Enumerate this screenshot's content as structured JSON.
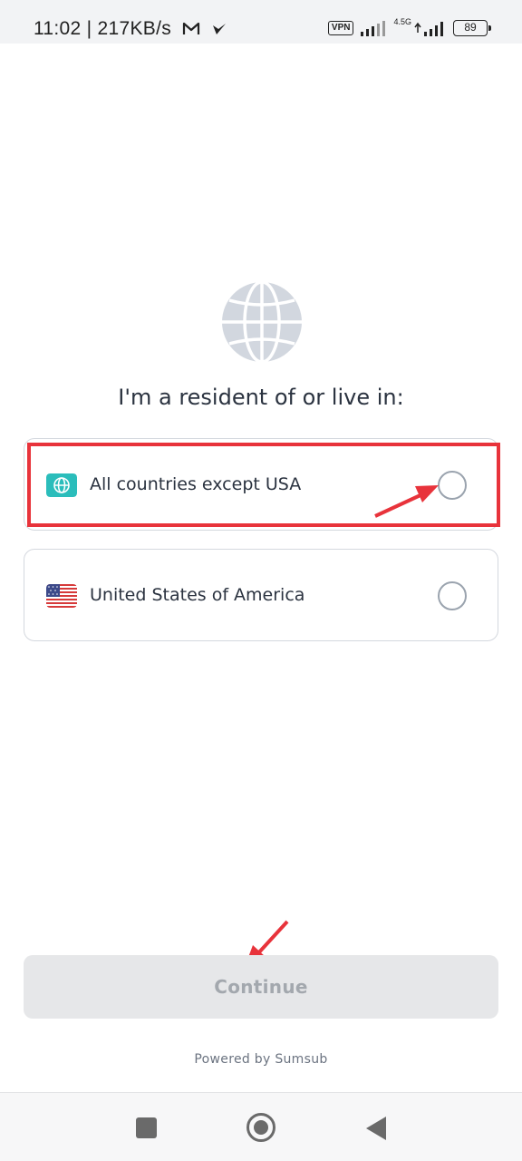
{
  "status_bar": {
    "time_speed": "11:02 | 217KB/s",
    "vpn": "VPN",
    "network": "4.5G",
    "battery": "89"
  },
  "main": {
    "globe_icon": "globe-icon",
    "title": "I'm a resident of or live in:",
    "options": [
      {
        "label": "All countries except USA",
        "icon": "globe-icon",
        "icon_color": "#2bbdbb",
        "selected": false
      },
      {
        "label": "United States of America",
        "icon": "us-flag-icon",
        "selected": false
      }
    ]
  },
  "footer": {
    "continue_label": "Continue",
    "powered_by": "Powered by Sumsub"
  },
  "colors": {
    "annotation": "#e8333b",
    "globe": "#d2d7df",
    "text": "#2b3340"
  }
}
